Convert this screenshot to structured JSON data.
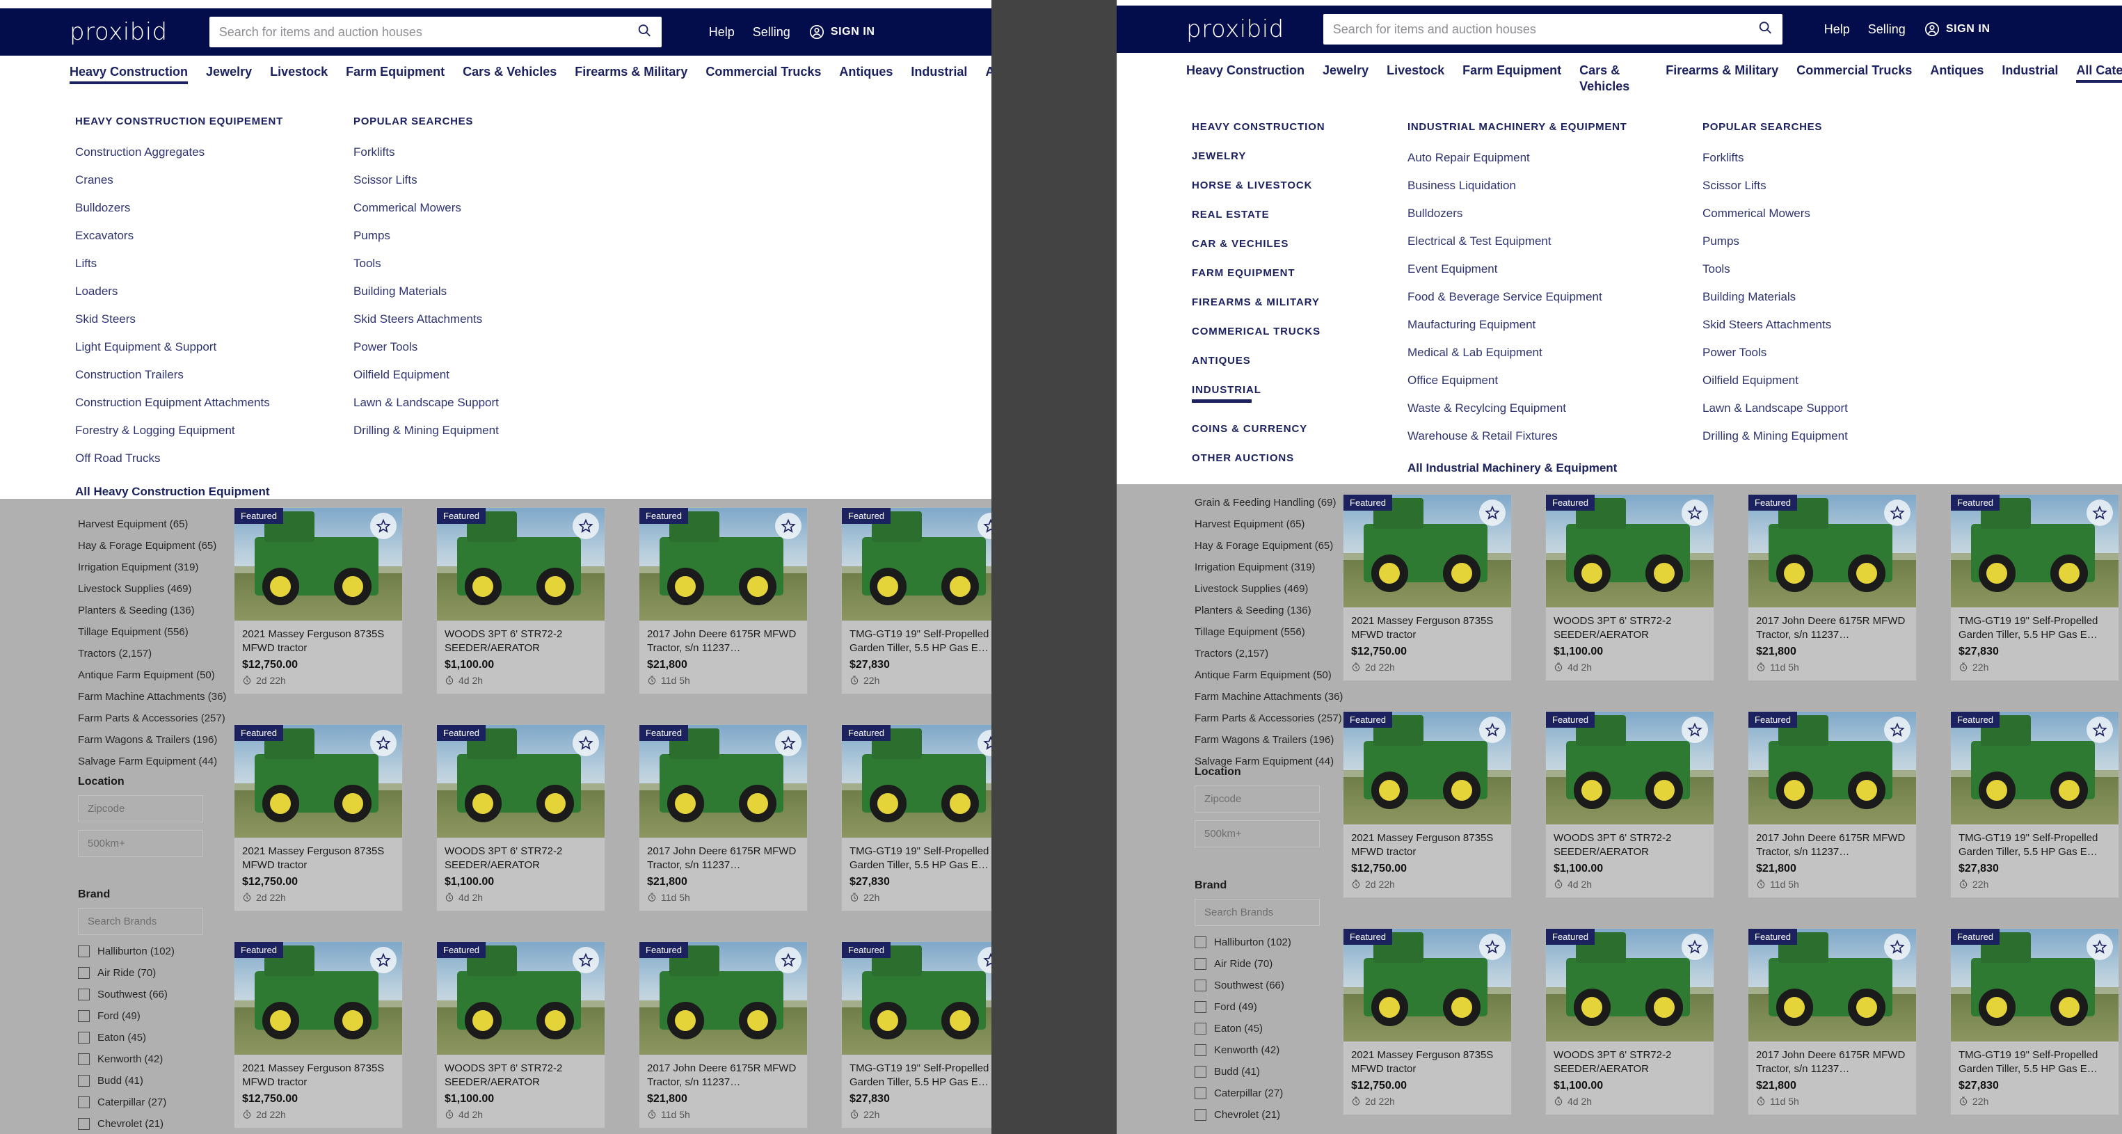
{
  "background_color": "#434343",
  "brand_color": "#040d4c",
  "accent_color": "#1c2260",
  "header": {
    "logo": "proxibid",
    "search_placeholder": "Search for items and auction houses",
    "search_value": "",
    "help_label": "Help",
    "selling_label": "Selling",
    "signin_label": "SIGN IN"
  },
  "category_nav": {
    "items": [
      "Heavy Construction",
      "Jewelry",
      "Livestock",
      "Farm Equipment",
      "Cars & Vehicles",
      "Firearms & Military",
      "Commercial Trucks",
      "Antiques",
      "Industrial",
      "All Catergories"
    ],
    "active_left": "Heavy Construction",
    "active_right": "All Catergories"
  },
  "mega_left": {
    "col1_heading": "HEAVY CONSTRUCTION EQUIPEMENT",
    "col1_items": [
      "Construction Aggregates",
      "Cranes",
      "Bulldozers",
      "Excavators",
      "Lifts",
      "Loaders",
      "Skid Steers",
      "Light Equipment & Support",
      "Construction Trailers",
      "Construction Equipment Attachments",
      "Forestry & Logging Equipment",
      "Off Road Trucks"
    ],
    "col1_footer": "All Heavy Construction Equipment",
    "col2_heading": "POPULAR SEARCHES",
    "col2_items": [
      "Forklifts",
      "Scissor Lifts",
      "Commerical Mowers",
      "Pumps",
      "Tools",
      "Building Materials",
      "Skid Steers Attachments",
      "Power Tools",
      "Oilfield Equipment",
      "Lawn & Landscape Support",
      "Drilling & Mining Equipment"
    ]
  },
  "mega_right": {
    "col1_items": [
      "HEAVY CONSTRUCTION",
      "JEWELRY",
      "HORSE & LIVESTOCK",
      "REAL ESTATE",
      "CAR & VECHILES",
      "FARM EQUIPMENT",
      "FIREARMS & MILITARY",
      "COMMERICAL TRUCKS",
      "ANTIQUES",
      "INDUSTRIAL",
      "COINS & CURRENCY",
      "OTHER AUCTIONS"
    ],
    "col1_active": "INDUSTRIAL",
    "col2_heading": "INDUSTRIAL MACHINERY & EQUIPMENT",
    "col2_items": [
      "Auto Repair Equipment",
      "Business Liquidation",
      "Bulldozers",
      "Electrical & Test Equipment",
      "Event Equipment",
      "Food & Beverage Service Equipment",
      "Maufacturing Equipment",
      "Medical & Lab Equipment",
      "Office Equipment",
      "Waste & Recylcing Equipment",
      "Warehouse & Retail Fixtures"
    ],
    "col2_footer": "All Industrial Machinery & Equipment",
    "col3_heading": "POPULAR SEARCHES",
    "col3_items": [
      "Forklifts",
      "Scissor Lifts",
      "Commerical Mowers",
      "Pumps",
      "Tools",
      "Building Materials",
      "Skid Steers Attachments",
      "Power Tools",
      "Oilfield Equipment",
      "Lawn & Landscape Support",
      "Drilling & Mining Equipment"
    ]
  },
  "sidebar": {
    "categories_left": [
      "Harvest Equipment (65)",
      "Hay & Forage Equipment (65)",
      "Irrigation Equipment (319)",
      "Livestock Supplies (469)",
      "Planters & Seeding (136)",
      "Tillage Equipment (556)",
      "Tractors (2,157)",
      "Antique Farm Equipment (50)",
      "Farm Machine Attachments (36)",
      "Farm Parts & Accessories (257)",
      "Farm Wagons & Trailers (196)",
      "Salvage Farm Equipment (44)"
    ],
    "categories_right": [
      "Grain & Feeding Handling (69)",
      "Harvest Equipment (65)",
      "Hay & Forage Equipment (65)",
      "Irrigation Equipment (319)",
      "Livestock Supplies (469)",
      "Planters & Seeding (136)",
      "Tillage Equipment (556)",
      "Tractors (2,157)",
      "Antique Farm Equipment (50)",
      "Farm Machine Attachments (36)",
      "Farm Parts & Accessories (257)",
      "Farm Wagons & Trailers (196)",
      "Salvage Farm Equipment (44)"
    ],
    "location_title": "Location",
    "zipcode_placeholder": "Zipcode",
    "zipcode_value": "",
    "radius_value": "500km+",
    "brand_title": "Brand",
    "brand_search_placeholder": "Search Brands",
    "brand_search_value": "",
    "brands": [
      "Halliburton (102)",
      "Air Ride (70)",
      "Southwest (66)",
      "Ford (49)",
      "Eaton (45)",
      "Kenworth (42)",
      "Budd (41)",
      "Caterpillar (27)",
      "Chevrolet (21)"
    ]
  },
  "products": [
    {
      "badge": "Featured",
      "title": "2021 Massey Ferguson 8735S MFWD tractor",
      "price": "$12,750.00",
      "time_left": "2d 22h"
    },
    {
      "badge": "Featured",
      "title": "WOODS 3PT 6' STR72-2 SEEDER/AERATOR",
      "price": "$1,100.00",
      "time_left": "4d 2h"
    },
    {
      "badge": "Featured",
      "title": "2017 John Deere 6175R MFWD Tractor, s/n 11237…",
      "price": "$21,800",
      "time_left": "11d 5h"
    },
    {
      "badge": "Featured",
      "title": "TMG-GT19 19\" Self-Propelled Garden Tiller, 5.5 HP Gas E…",
      "price": "$27,830",
      "time_left": "22h"
    }
  ]
}
